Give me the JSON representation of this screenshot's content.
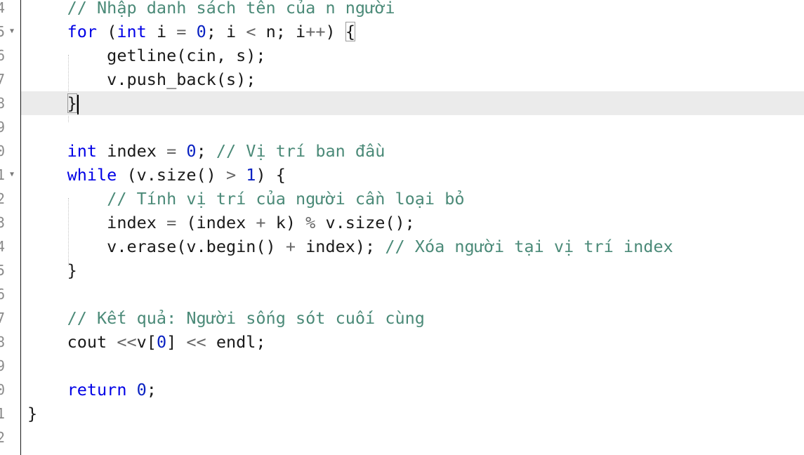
{
  "editor": {
    "current_line_index": 4,
    "gutter": [
      {
        "number": "4",
        "fold": ""
      },
      {
        "number": "5",
        "fold": "▼"
      },
      {
        "number": "6",
        "fold": ""
      },
      {
        "number": "7",
        "fold": ""
      },
      {
        "number": "8",
        "fold": ""
      },
      {
        "number": "9",
        "fold": ""
      },
      {
        "number": "0",
        "fold": ""
      },
      {
        "number": "1",
        "fold": "▼"
      },
      {
        "number": "2",
        "fold": ""
      },
      {
        "number": "3",
        "fold": ""
      },
      {
        "number": "4",
        "fold": ""
      },
      {
        "number": "5",
        "fold": ""
      },
      {
        "number": "6",
        "fold": ""
      },
      {
        "number": "7",
        "fold": ""
      },
      {
        "number": "8",
        "fold": ""
      },
      {
        "number": "9",
        "fold": ""
      },
      {
        "number": "0",
        "fold": ""
      },
      {
        "number": "1",
        "fold": ""
      },
      {
        "number": "2",
        "fold": ""
      }
    ],
    "lines": [
      [
        [
          "    ",
          ""
        ],
        [
          "// Nhập danh sách tên của n người",
          "com"
        ]
      ],
      [
        [
          "    ",
          ""
        ],
        [
          "for",
          "kw"
        ],
        [
          " (",
          ""
        ],
        [
          "int",
          "kw"
        ],
        [
          " i ",
          ""
        ],
        [
          "=",
          "op"
        ],
        [
          " ",
          ""
        ],
        [
          "0",
          "num"
        ],
        [
          "; i ",
          ""
        ],
        [
          "<",
          "op"
        ],
        [
          " n; i",
          ""
        ],
        [
          "++",
          "op"
        ],
        [
          ") ",
          ""
        ],
        [
          "{",
          "brace"
        ]
      ],
      [
        [
          "        getline(cin, s);",
          ""
        ]
      ],
      [
        [
          "        v.push_back(s);",
          ""
        ]
      ],
      [
        [
          "    ",
          ""
        ],
        [
          "}",
          "brace"
        ],
        [
          "",
          "caret"
        ]
      ],
      [],
      [
        [
          "    ",
          ""
        ],
        [
          "int",
          "kw"
        ],
        [
          " index ",
          ""
        ],
        [
          "=",
          "op"
        ],
        [
          " ",
          ""
        ],
        [
          "0",
          "num"
        ],
        [
          "; ",
          ""
        ],
        [
          "// Vị trí ban đầu",
          "com"
        ]
      ],
      [
        [
          "    ",
          ""
        ],
        [
          "while",
          "kw"
        ],
        [
          " (v.size() ",
          ""
        ],
        [
          ">",
          "op"
        ],
        [
          " ",
          ""
        ],
        [
          "1",
          "num"
        ],
        [
          ") {",
          ""
        ]
      ],
      [
        [
          "        ",
          ""
        ],
        [
          "// Tính vị trí của người cần loại bỏ",
          "com"
        ]
      ],
      [
        [
          "        index ",
          ""
        ],
        [
          "=",
          "op"
        ],
        [
          " (index ",
          ""
        ],
        [
          "+",
          "op"
        ],
        [
          " k) ",
          ""
        ],
        [
          "%",
          "op"
        ],
        [
          " v.size();",
          ""
        ]
      ],
      [
        [
          "        v.erase(v.begin() ",
          ""
        ],
        [
          "+",
          "op"
        ],
        [
          " index); ",
          ""
        ],
        [
          "// Xóa người tại vị trí index",
          "com"
        ]
      ],
      [
        [
          "    }",
          ""
        ]
      ],
      [],
      [
        [
          "    ",
          ""
        ],
        [
          "// Kết quả: Người sống sót cuối cùng",
          "com"
        ]
      ],
      [
        [
          "    cout ",
          ""
        ],
        [
          "<<",
          "op"
        ],
        [
          "v[",
          ""
        ],
        [
          "0",
          "num"
        ],
        [
          "] ",
          ""
        ],
        [
          "<<",
          "op"
        ],
        [
          " endl;",
          ""
        ]
      ],
      [],
      [
        [
          "    ",
          ""
        ],
        [
          "return",
          "kw"
        ],
        [
          " ",
          ""
        ],
        [
          "0",
          "num"
        ],
        [
          ";",
          ""
        ]
      ],
      [
        [
          "}",
          ""
        ]
      ],
      []
    ]
  }
}
